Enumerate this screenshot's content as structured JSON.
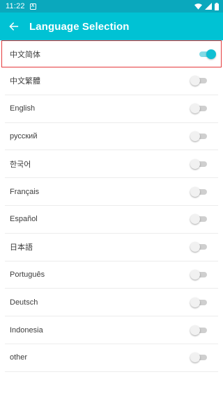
{
  "status_bar": {
    "time": "11:22",
    "notification_icon": "A",
    "icons": [
      "wifi-icon",
      "signal-icon",
      "battery-icon"
    ]
  },
  "app_bar": {
    "title": "Language Selection",
    "back_icon": "arrow-back-icon"
  },
  "languages": [
    {
      "label": "中文简体",
      "enabled": true
    },
    {
      "label": "中文繁體",
      "enabled": false
    },
    {
      "label": "English",
      "enabled": false
    },
    {
      "label": "русский",
      "enabled": false
    },
    {
      "label": "한국어",
      "enabled": false
    },
    {
      "label": "Français",
      "enabled": false
    },
    {
      "label": "Español",
      "enabled": false
    },
    {
      "label": "日本語",
      "enabled": false
    },
    {
      "label": "Português",
      "enabled": false
    },
    {
      "label": "Deutsch",
      "enabled": false
    },
    {
      "label": "Indonesia",
      "enabled": false
    },
    {
      "label": "other",
      "enabled": false
    }
  ],
  "colors": {
    "status_bar": "#0aa8bd",
    "app_bar": "#00c2d4",
    "switch_on": "#10bfd3",
    "highlight_border": "#e5393b"
  }
}
